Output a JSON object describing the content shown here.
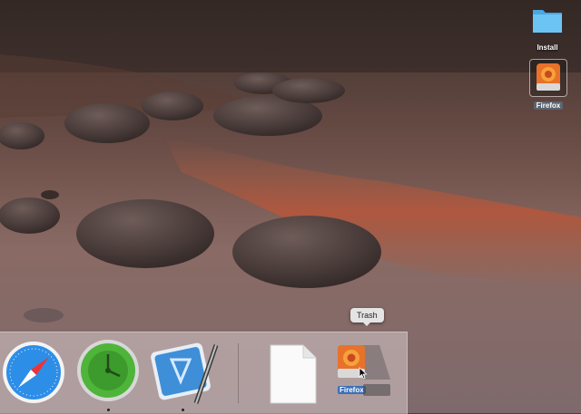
{
  "desktop": {
    "icons": [
      {
        "id": "install",
        "label": "Install",
        "icon": "folder-icon",
        "selected": false
      },
      {
        "id": "firefox",
        "label": "Firefox",
        "icon": "firefox-disk-icon",
        "selected": true
      }
    ]
  },
  "dock": {
    "apps": [
      {
        "id": "safari",
        "icon": "safari-compass-icon",
        "running": false
      },
      {
        "id": "clock",
        "icon": "clock-icon",
        "running": true
      },
      {
        "id": "xcode",
        "icon": "xcode-icon",
        "running": true
      }
    ],
    "stacks": [
      {
        "id": "document",
        "icon": "blank-document-icon"
      },
      {
        "id": "trash",
        "icon": "firefox-disk-icon",
        "tooltip": "Trash",
        "drag_label": "Firefox"
      }
    ]
  },
  "colors": {
    "folder": "#5ab8ee",
    "firefox_orange": "#e8722a",
    "selection": "#3b6fb6"
  }
}
